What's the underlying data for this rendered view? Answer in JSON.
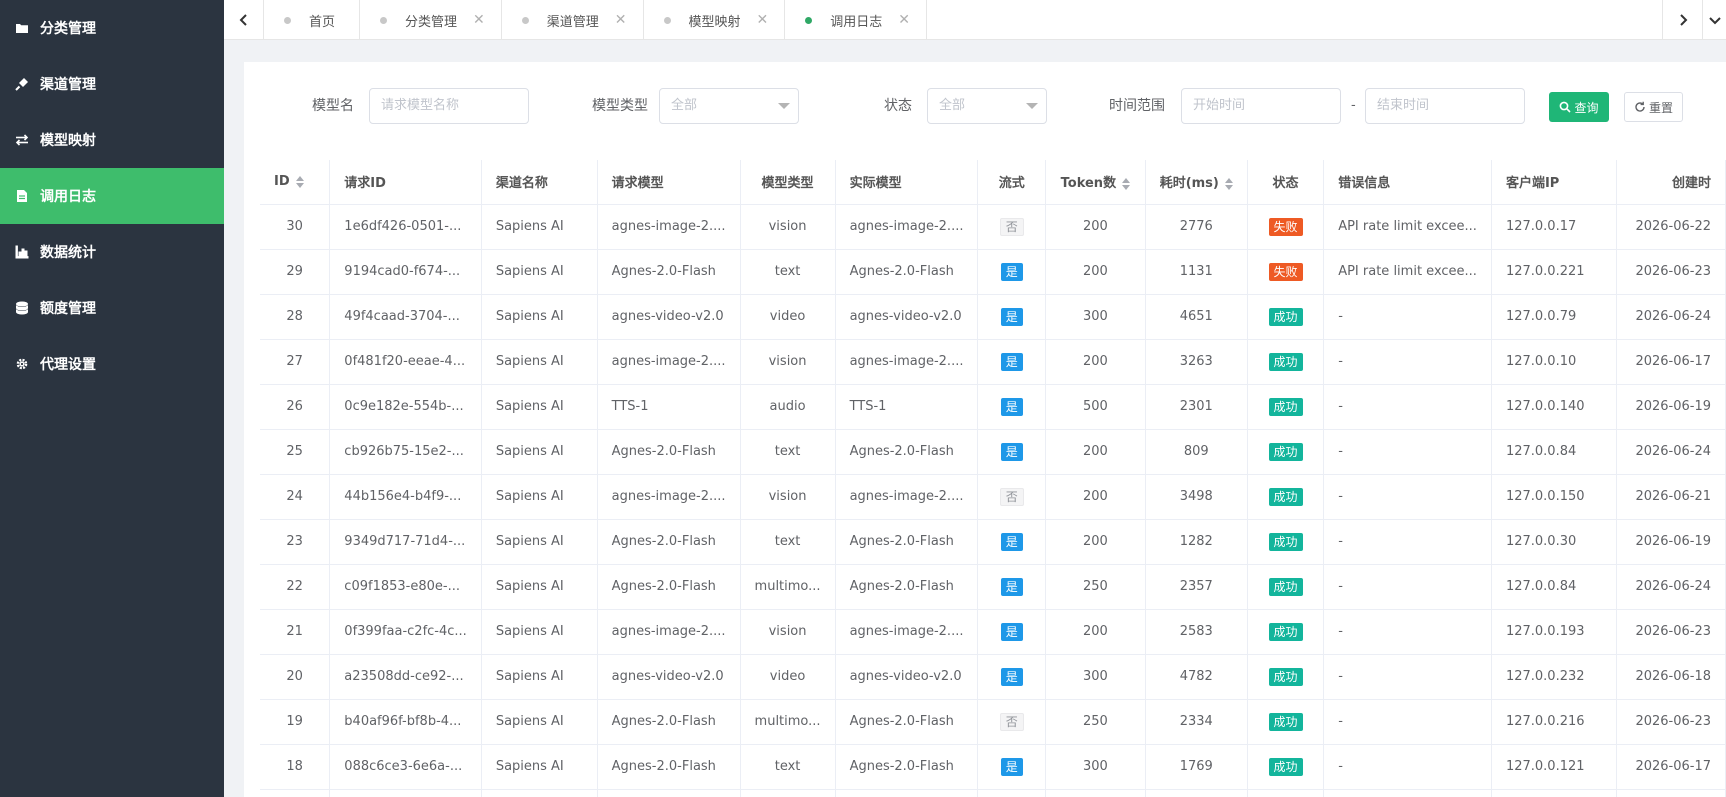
{
  "sidebar": {
    "items": [
      {
        "label": "分类管理",
        "icon": "folder-icon"
      },
      {
        "label": "渠道管理",
        "icon": "plug-icon"
      },
      {
        "label": "模型映射",
        "icon": "exchange-icon"
      },
      {
        "label": "调用日志",
        "icon": "file-icon",
        "active": true
      },
      {
        "label": "数据统计",
        "icon": "bar-chart-icon"
      },
      {
        "label": "额度管理",
        "icon": "database-icon"
      },
      {
        "label": "代理设置",
        "icon": "gear-icon"
      }
    ]
  },
  "tabs": [
    {
      "label": "首页",
      "closable": false,
      "active": false
    },
    {
      "label": "分类管理",
      "closable": true,
      "active": false
    },
    {
      "label": "渠道管理",
      "closable": true,
      "active": false
    },
    {
      "label": "模型映射",
      "closable": true,
      "active": false
    },
    {
      "label": "调用日志",
      "closable": true,
      "active": true
    }
  ],
  "filter": {
    "model_name_label": "模型名",
    "model_name_placeholder": "请求模型名称",
    "model_type_label": "模型类型",
    "model_type_value": "全部",
    "status_label": "状态",
    "status_value": "全部",
    "time_range_label": "时间范围",
    "start_placeholder": "开始时间",
    "range_separator": "-",
    "end_placeholder": "结束时间",
    "search_label": "查询",
    "reset_label": "重置"
  },
  "table": {
    "headers": {
      "id": "ID",
      "request_id": "请求ID",
      "channel": "渠道名称",
      "request_model": "请求模型",
      "model_type": "模型类型",
      "actual_model": "实际模型",
      "stream": "流式",
      "tokens": "Token数",
      "latency": "耗时(ms)",
      "status": "状态",
      "error": "错误信息",
      "client_ip": "客户端IP",
      "created": "创建时"
    },
    "rows": [
      {
        "id": "30",
        "request_id": "1e6df426-0501-...",
        "channel": "Sapiens AI",
        "request_model": "agnes-image-2....",
        "model_type": "vision",
        "actual_model": "agnes-image-2....",
        "stream": "否",
        "tokens": "200",
        "latency": "2776",
        "status": "失败",
        "error": "API rate limit excee...",
        "client_ip": "127.0.0.17",
        "created": "2026-06-22"
      },
      {
        "id": "29",
        "request_id": "9194cad0-f674-...",
        "channel": "Sapiens AI",
        "request_model": "Agnes-2.0-Flash",
        "model_type": "text",
        "actual_model": "Agnes-2.0-Flash",
        "stream": "是",
        "tokens": "200",
        "latency": "1131",
        "status": "失败",
        "error": "API rate limit excee...",
        "client_ip": "127.0.0.221",
        "created": "2026-06-23"
      },
      {
        "id": "28",
        "request_id": "49f4caad-3704-...",
        "channel": "Sapiens AI",
        "request_model": "agnes-video-v2.0",
        "model_type": "video",
        "actual_model": "agnes-video-v2.0",
        "stream": "是",
        "tokens": "300",
        "latency": "4651",
        "status": "成功",
        "error": "-",
        "client_ip": "127.0.0.79",
        "created": "2026-06-24"
      },
      {
        "id": "27",
        "request_id": "0f481f20-eeae-4...",
        "channel": "Sapiens AI",
        "request_model": "agnes-image-2....",
        "model_type": "vision",
        "actual_model": "agnes-image-2....",
        "stream": "是",
        "tokens": "200",
        "latency": "3263",
        "status": "成功",
        "error": "-",
        "client_ip": "127.0.0.10",
        "created": "2026-06-17"
      },
      {
        "id": "26",
        "request_id": "0c9e182e-554b-...",
        "channel": "Sapiens AI",
        "request_model": "TTS-1",
        "model_type": "audio",
        "actual_model": "TTS-1",
        "stream": "是",
        "tokens": "500",
        "latency": "2301",
        "status": "成功",
        "error": "-",
        "client_ip": "127.0.0.140",
        "created": "2026-06-19"
      },
      {
        "id": "25",
        "request_id": "cb926b75-15e2-...",
        "channel": "Sapiens AI",
        "request_model": "Agnes-2.0-Flash",
        "model_type": "text",
        "actual_model": "Agnes-2.0-Flash",
        "stream": "是",
        "tokens": "200",
        "latency": "809",
        "status": "成功",
        "error": "-",
        "client_ip": "127.0.0.84",
        "created": "2026-06-24"
      },
      {
        "id": "24",
        "request_id": "44b156e4-b4f9-...",
        "channel": "Sapiens AI",
        "request_model": "agnes-image-2....",
        "model_type": "vision",
        "actual_model": "agnes-image-2....",
        "stream": "否",
        "tokens": "200",
        "latency": "3498",
        "status": "成功",
        "error": "-",
        "client_ip": "127.0.0.150",
        "created": "2026-06-21"
      },
      {
        "id": "23",
        "request_id": "9349d717-71d4-...",
        "channel": "Sapiens AI",
        "request_model": "Agnes-2.0-Flash",
        "model_type": "text",
        "actual_model": "Agnes-2.0-Flash",
        "stream": "是",
        "tokens": "200",
        "latency": "1282",
        "status": "成功",
        "error": "-",
        "client_ip": "127.0.0.30",
        "created": "2026-06-19"
      },
      {
        "id": "22",
        "request_id": "c09f1853-e80e-...",
        "channel": "Sapiens AI",
        "request_model": "Agnes-2.0-Flash",
        "model_type": "multimo...",
        "actual_model": "Agnes-2.0-Flash",
        "stream": "是",
        "tokens": "250",
        "latency": "2357",
        "status": "成功",
        "error": "-",
        "client_ip": "127.0.0.84",
        "created": "2026-06-24"
      },
      {
        "id": "21",
        "request_id": "0f399faa-c2fc-4c...",
        "channel": "Sapiens AI",
        "request_model": "agnes-image-2....",
        "model_type": "vision",
        "actual_model": "agnes-image-2....",
        "stream": "是",
        "tokens": "200",
        "latency": "2583",
        "status": "成功",
        "error": "-",
        "client_ip": "127.0.0.193",
        "created": "2026-06-23"
      },
      {
        "id": "20",
        "request_id": "a23508dd-ce92-...",
        "channel": "Sapiens AI",
        "request_model": "agnes-video-v2.0",
        "model_type": "video",
        "actual_model": "agnes-video-v2.0",
        "stream": "是",
        "tokens": "300",
        "latency": "4782",
        "status": "成功",
        "error": "-",
        "client_ip": "127.0.0.232",
        "created": "2026-06-18"
      },
      {
        "id": "19",
        "request_id": "b40af96f-bf8b-4...",
        "channel": "Sapiens AI",
        "request_model": "Agnes-2.0-Flash",
        "model_type": "multimo...",
        "actual_model": "Agnes-2.0-Flash",
        "stream": "否",
        "tokens": "250",
        "latency": "2334",
        "status": "成功",
        "error": "-",
        "client_ip": "127.0.0.216",
        "created": "2026-06-23"
      },
      {
        "id": "18",
        "request_id": "088c6ce3-6e6a-...",
        "channel": "Sapiens AI",
        "request_model": "Agnes-2.0-Flash",
        "model_type": "text",
        "actual_model": "Agnes-2.0-Flash",
        "stream": "是",
        "tokens": "300",
        "latency": "1769",
        "status": "成功",
        "error": "-",
        "client_ip": "127.0.0.121",
        "created": "2026-06-17"
      },
      {
        "id": "",
        "request_id": "",
        "channel": "",
        "request_model": "",
        "model_type": "",
        "actual_model": "",
        "stream": "",
        "tokens": "",
        "latency": "",
        "status": "",
        "error": "",
        "client_ip": "",
        "created": ""
      }
    ]
  },
  "colors": {
    "sidebar_bg": "#2b3440",
    "active_green": "#3ebd6c",
    "primary_button": "#1fb677",
    "tag_yes": "#1e98e8",
    "tag_fail": "#ee5a24",
    "tag_success": "#13b59c"
  }
}
